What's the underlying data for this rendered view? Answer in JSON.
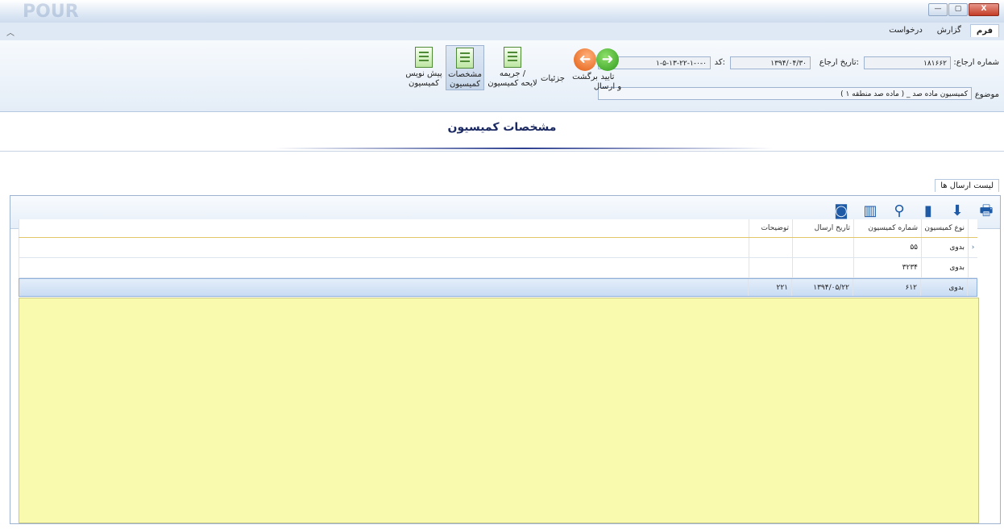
{
  "window": {
    "logo_ghost": "POUR",
    "min": "—",
    "max": "▢",
    "close": "X"
  },
  "menu": {
    "tabs": [
      "فرم",
      "گزارش",
      "درخواست"
    ],
    "active": 0,
    "collapse": "︿"
  },
  "form": {
    "ref_number_label": ":شماره ارجاع",
    "ref_number_value": "۱۸۱۶۶۲",
    "ref_date_label": "تاریخ ارجاع:",
    "ref_date_value": "۱۳۹۴/۰۴/۳۰",
    "code_label": "کد:",
    "code_value": "۱-۵-۱۳-۲۲-۱-۰-۰",
    "subject_label": "موضوع",
    "subject_value": "کمیسیون ماده صد _ ( ماده صد منطقه ۱ )"
  },
  "actions": {
    "approve_send": [
      "تایید",
      "و ارسال"
    ],
    "back": "برگشت",
    "details": "جزئیات",
    "fine": [
      "جریمه /",
      "لایحه کمیسیون"
    ],
    "commission_spec": [
      "مشخصات",
      "کمیسیون"
    ],
    "draft": [
      "پیش نویس",
      "کمیسیون"
    ]
  },
  "page_title": "مشخصات کمیسیون",
  "subtab": "لیست ارسال ها",
  "toolbar_icons": [
    "print-icon",
    "download-icon",
    "export-icon",
    "link-icon",
    "columns-icon",
    "camera-icon"
  ],
  "grid": {
    "columns": [
      "نوع کمیسیون",
      "شماره کمیسیون",
      "تاریخ ارسال",
      "توضیحات"
    ],
    "rows": [
      {
        "type": "بدوی",
        "number": "۵۵",
        "date": "",
        "note": "",
        "current": true
      },
      {
        "type": "بدوی",
        "number": "۳۲۳۴",
        "date": "",
        "note": ""
      },
      {
        "type": "بدوی",
        "number": "۶۱۲",
        "date": "۱۳۹۴/۰۵/۲۲",
        "note": "۲۲۱",
        "selected": true
      }
    ]
  },
  "colors": {
    "accent": "#1c2a63",
    "grid_empty": "#fafaaf",
    "selected_row": "#cfe0f5"
  }
}
